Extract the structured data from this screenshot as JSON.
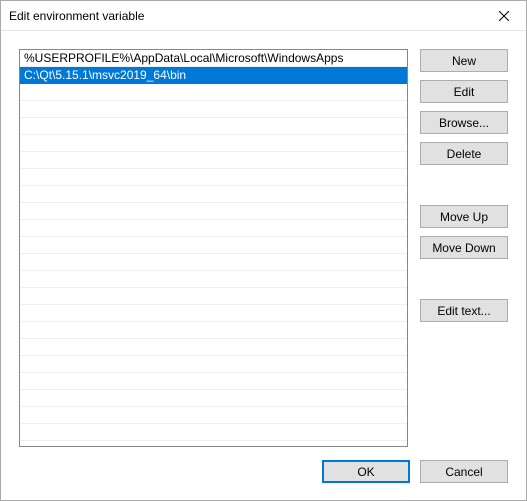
{
  "window": {
    "title": "Edit environment variable"
  },
  "list": {
    "entries": [
      "%USERPROFILE%\\AppData\\Local\\Microsoft\\WindowsApps",
      "C:\\Qt\\5.15.1\\msvc2019_64\\bin"
    ],
    "selected_index": 1
  },
  "buttons": {
    "new": "New",
    "edit": "Edit",
    "browse": "Browse...",
    "delete": "Delete",
    "move_up": "Move Up",
    "move_down": "Move Down",
    "edit_text": "Edit text...",
    "ok": "OK",
    "cancel": "Cancel"
  }
}
